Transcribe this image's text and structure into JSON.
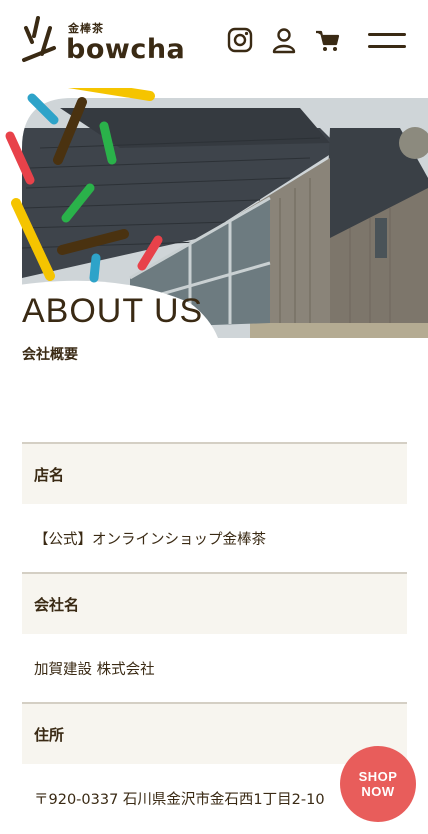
{
  "header": {
    "logo_sub": "金棒茶",
    "logo_text": "bowcha",
    "icons": [
      "instagram-icon",
      "user-icon",
      "cart-icon",
      "menu-icon"
    ]
  },
  "hero": {
    "title": "ABOUT US",
    "subtitle": "会社概要"
  },
  "info": {
    "rows": [
      {
        "label": "店名",
        "value": "【公式】オンラインショップ金棒茶"
      },
      {
        "label": "会社名",
        "value": "加賀建設 株式会社"
      },
      {
        "label": "住所",
        "value": "〒920-0337 石川県金沢市金石西1丁目2-10"
      }
    ]
  },
  "shop_now": {
    "line1": "SHOP",
    "line2": "NOW"
  },
  "colors": {
    "brand_brown": "#3a2a14",
    "shop_red": "#e85d5b",
    "table_bg": "#f7f5ef",
    "stick_yellow": "#f5c400",
    "stick_red": "#e8424a",
    "stick_blue": "#2ea3c9",
    "stick_green": "#2ab24a",
    "stick_brown": "#4a3210"
  }
}
